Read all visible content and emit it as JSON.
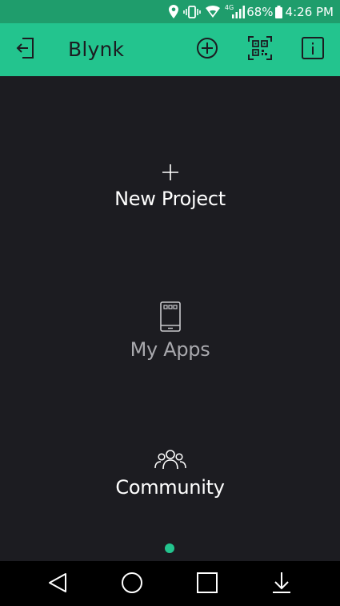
{
  "status_bar": {
    "icons": [
      "location-icon",
      "vibrate-icon",
      "wifi-icon",
      "signal-icon",
      "battery-icon"
    ],
    "network_label": "4G",
    "battery_percent": "68%",
    "time": "4:26 PM"
  },
  "app_bar": {
    "title": "Blynk",
    "icons": [
      "logout-icon",
      "add-circle-icon",
      "qr-code-icon",
      "info-icon"
    ]
  },
  "menu": {
    "new_project": {
      "label": "New Project",
      "icon": "plus-icon"
    },
    "my_apps": {
      "label": "My Apps",
      "icon": "phone-icon"
    },
    "community": {
      "label": "Community",
      "icon": "people-icon"
    }
  },
  "pager": {
    "current_page": 1
  },
  "nav_bar": {
    "icons": [
      "back-icon",
      "home-icon",
      "recents-icon",
      "notifications-pulldown-icon"
    ]
  },
  "colors": {
    "accent": "#23c48e",
    "status_bar": "#1f9d6c",
    "background": "#1c1c21",
    "text_primary": "#ffffff",
    "text_secondary": "#a8a8ad"
  }
}
